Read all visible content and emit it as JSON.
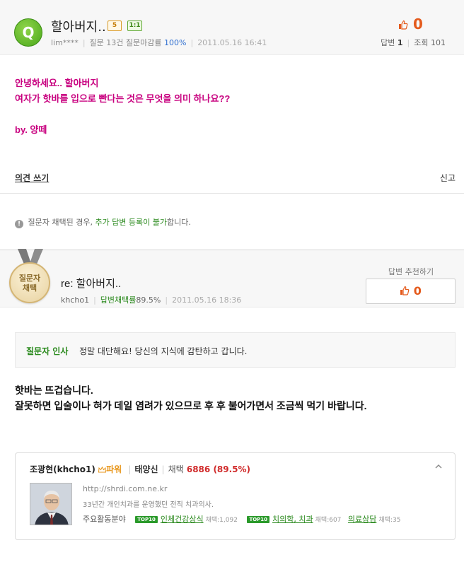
{
  "question": {
    "badge": "Q",
    "title": "할아버지..",
    "level_badges": [
      "5",
      "1:1"
    ],
    "author": "lim****",
    "asked_label": "질문 13건",
    "close_rate_label": "질문마감률",
    "close_rate": "100%",
    "date": "2011.05.16 16:41",
    "likes": "0",
    "answers_label": "답변",
    "answers_count": "1",
    "views_label": "조회",
    "views_count": "101",
    "body_lines": [
      "안녕하세요.. 할아버지",
      "여자가 핫바를 입으로 빤다는 것은 무엇을 의미 하나요??",
      "by. 양떼"
    ]
  },
  "opinion_link": "의견 쓰기",
  "report_link": "신고",
  "notice": {
    "icon": "!",
    "before": "질문자 채택된 경우,",
    "highlight": "추가 답변 등록이 불가",
    "after": "합니다."
  },
  "answer": {
    "medal_lines": [
      "질문자",
      "채택"
    ],
    "title": "re: 할아버지..",
    "author": "khcho1",
    "rate_label": "답변채택률",
    "rate": "89.5%",
    "date": "2011.05.16 18:36",
    "recommend_label": "답변 추천하기",
    "recommend_count": "0",
    "greeting_label": "질문자 인사",
    "greeting_text": "정말 대단해요! 당신의 지식에 감탄하고 갑니다.",
    "body_lines": [
      "핫바는 뜨겁습니다.",
      "잘못하면 입술이나 혀가 데일 염려가 있으므로 후 후 불어가면서 조금씩 먹기 바랍니다."
    ]
  },
  "profile": {
    "name": "조광현(khcho1)",
    "power": "파워",
    "level": "태양신",
    "adopt_label": "채택",
    "adopt_count": "6886",
    "adopt_rate": "(89.5%)",
    "url": "http://shrdi.com.ne.kr",
    "desc": "33년간 개인치과를 운영했던 전직 치과의사.",
    "fields_label": "주요활동분야",
    "top_badge": "TOP10",
    "fields": [
      {
        "name": "인체건강상식",
        "count_label": "채택:1,092"
      },
      {
        "name": "치의학, 치과",
        "count_label": "채택:607"
      },
      {
        "name": "의료상담",
        "count_label": "채택:35"
      }
    ]
  },
  "colors": {
    "question_text": "#c8007f",
    "accent_green": "#2b8a1e",
    "like_orange": "#e45a1c"
  }
}
